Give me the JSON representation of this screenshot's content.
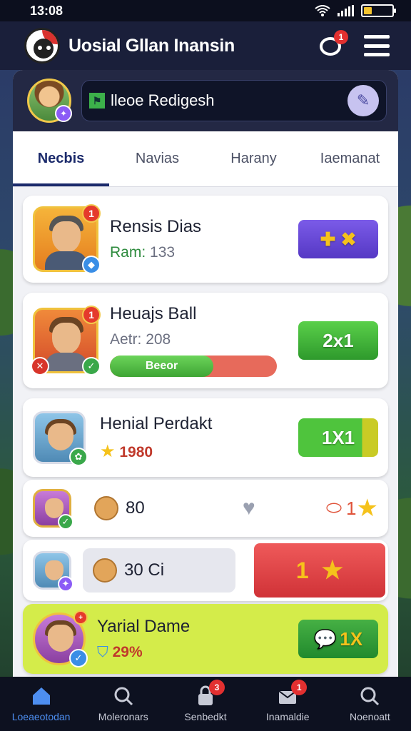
{
  "status_bar": {
    "time": "13:08"
  },
  "header": {
    "title": "Uosial Gllan Inansin",
    "chat_badge": "1"
  },
  "profile": {
    "name": "lleoe Redigesh"
  },
  "tabs": [
    {
      "label": "Necbis",
      "active": true
    },
    {
      "label": "Navias",
      "active": false
    },
    {
      "label": "Harany",
      "active": false
    },
    {
      "label": "Iaemanat",
      "active": false
    }
  ],
  "cards": {
    "c1": {
      "title": "Rensis Dias",
      "sub_label": "Ram:",
      "sub_value": "133",
      "badge": "1"
    },
    "c2": {
      "title": "Heuajs Ball",
      "sub_label": "Aetr:",
      "sub_value": "208",
      "badge": "1",
      "progress_label": "Beeor",
      "progress": 0.62,
      "button": "2x1"
    },
    "c3": {
      "title": "Henial Perdakt",
      "score": "1980",
      "button": "1X1"
    },
    "c4": {
      "count": "80",
      "right_value": "1"
    },
    "c5": {
      "count": "30 Ci",
      "button_value": "1"
    },
    "c6": {
      "title": "Yarial Dame",
      "percent": "29%",
      "button": "1X"
    }
  },
  "bottom_nav": [
    {
      "label": "Loeaeotodan",
      "active": true,
      "badge": ""
    },
    {
      "label": "Moleronars",
      "active": false,
      "badge": ""
    },
    {
      "label": "Senbedkt",
      "active": false,
      "badge": "3"
    },
    {
      "label": "Inamaldie",
      "active": false,
      "badge": "1"
    },
    {
      "label": "Noenoatt",
      "active": false,
      "badge": ""
    }
  ],
  "colors": {
    "accent": "#1b2a6b",
    "green": "#3ea534",
    "red": "#d03237",
    "purple": "#5538c4"
  }
}
